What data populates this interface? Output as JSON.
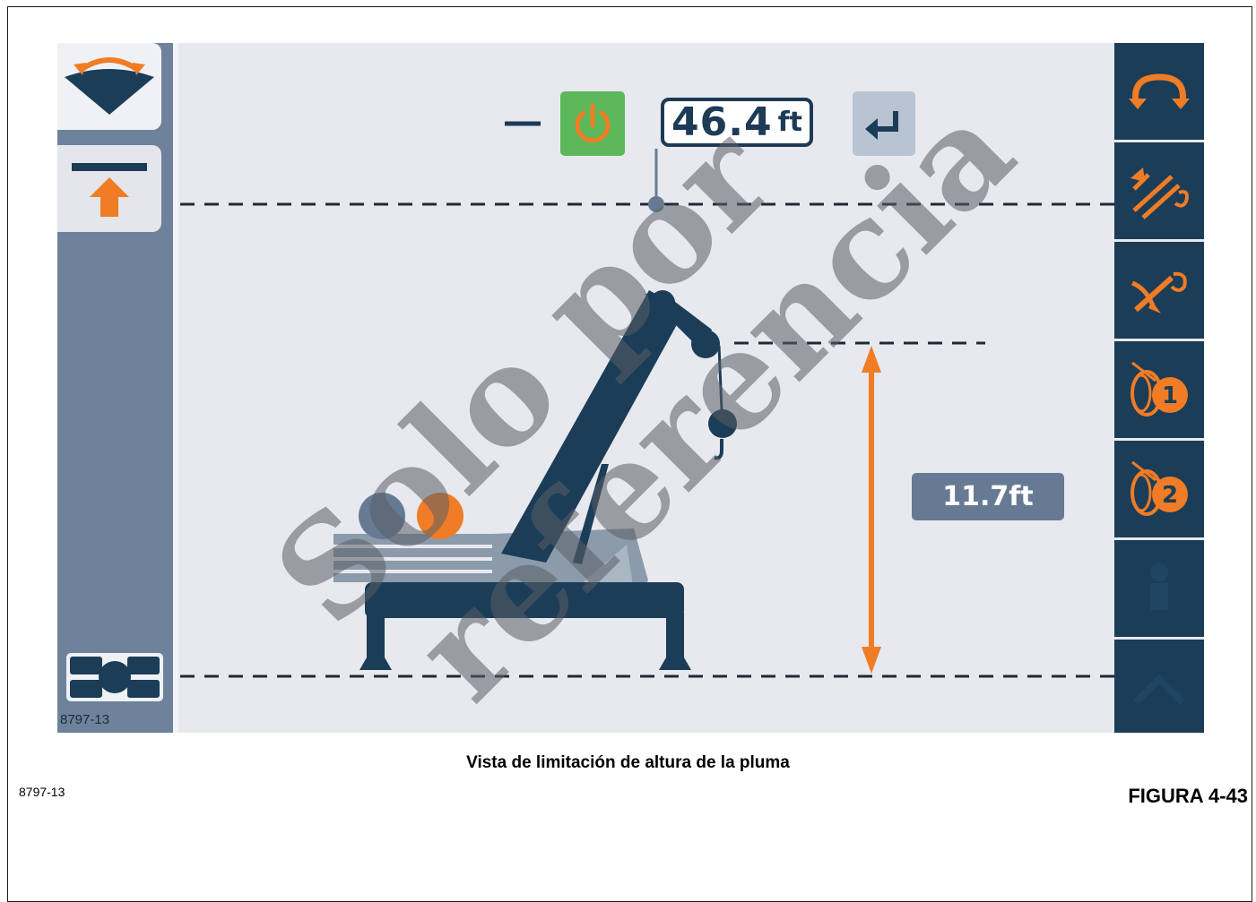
{
  "screen": {
    "limit_value": "46.4",
    "limit_unit": "ft",
    "current_height": "11.7ft",
    "image_code": "8797-13"
  },
  "left_panel": {
    "buttons": [
      {
        "icon": "swing-range-icon"
      },
      {
        "icon": "height-limit-icon"
      }
    ],
    "bottom_icon": "outrigger-icon"
  },
  "right_panel": {
    "buttons": [
      {
        "icon": "swing-icon"
      },
      {
        "icon": "boom-extend-icon"
      },
      {
        "icon": "boom-lift-icon"
      },
      {
        "icon": "winch-1-icon",
        "number": "1"
      },
      {
        "icon": "winch-2-icon",
        "number": "2"
      },
      {
        "icon": "blank-icon"
      },
      {
        "icon": "blank-icon"
      }
    ]
  },
  "figure": {
    "caption": "Vista de limitación de altura de la pluma",
    "code": "8797-13",
    "label": "FIGURA 4-43"
  },
  "watermark": {
    "line1": "Solo por",
    "line2": "referencia"
  },
  "colors": {
    "navy": "#1b3d58",
    "orange": "#f07c25",
    "green": "#5cb85a",
    "panel": "#6e829c",
    "screen_bg": "#e7e9ee"
  }
}
